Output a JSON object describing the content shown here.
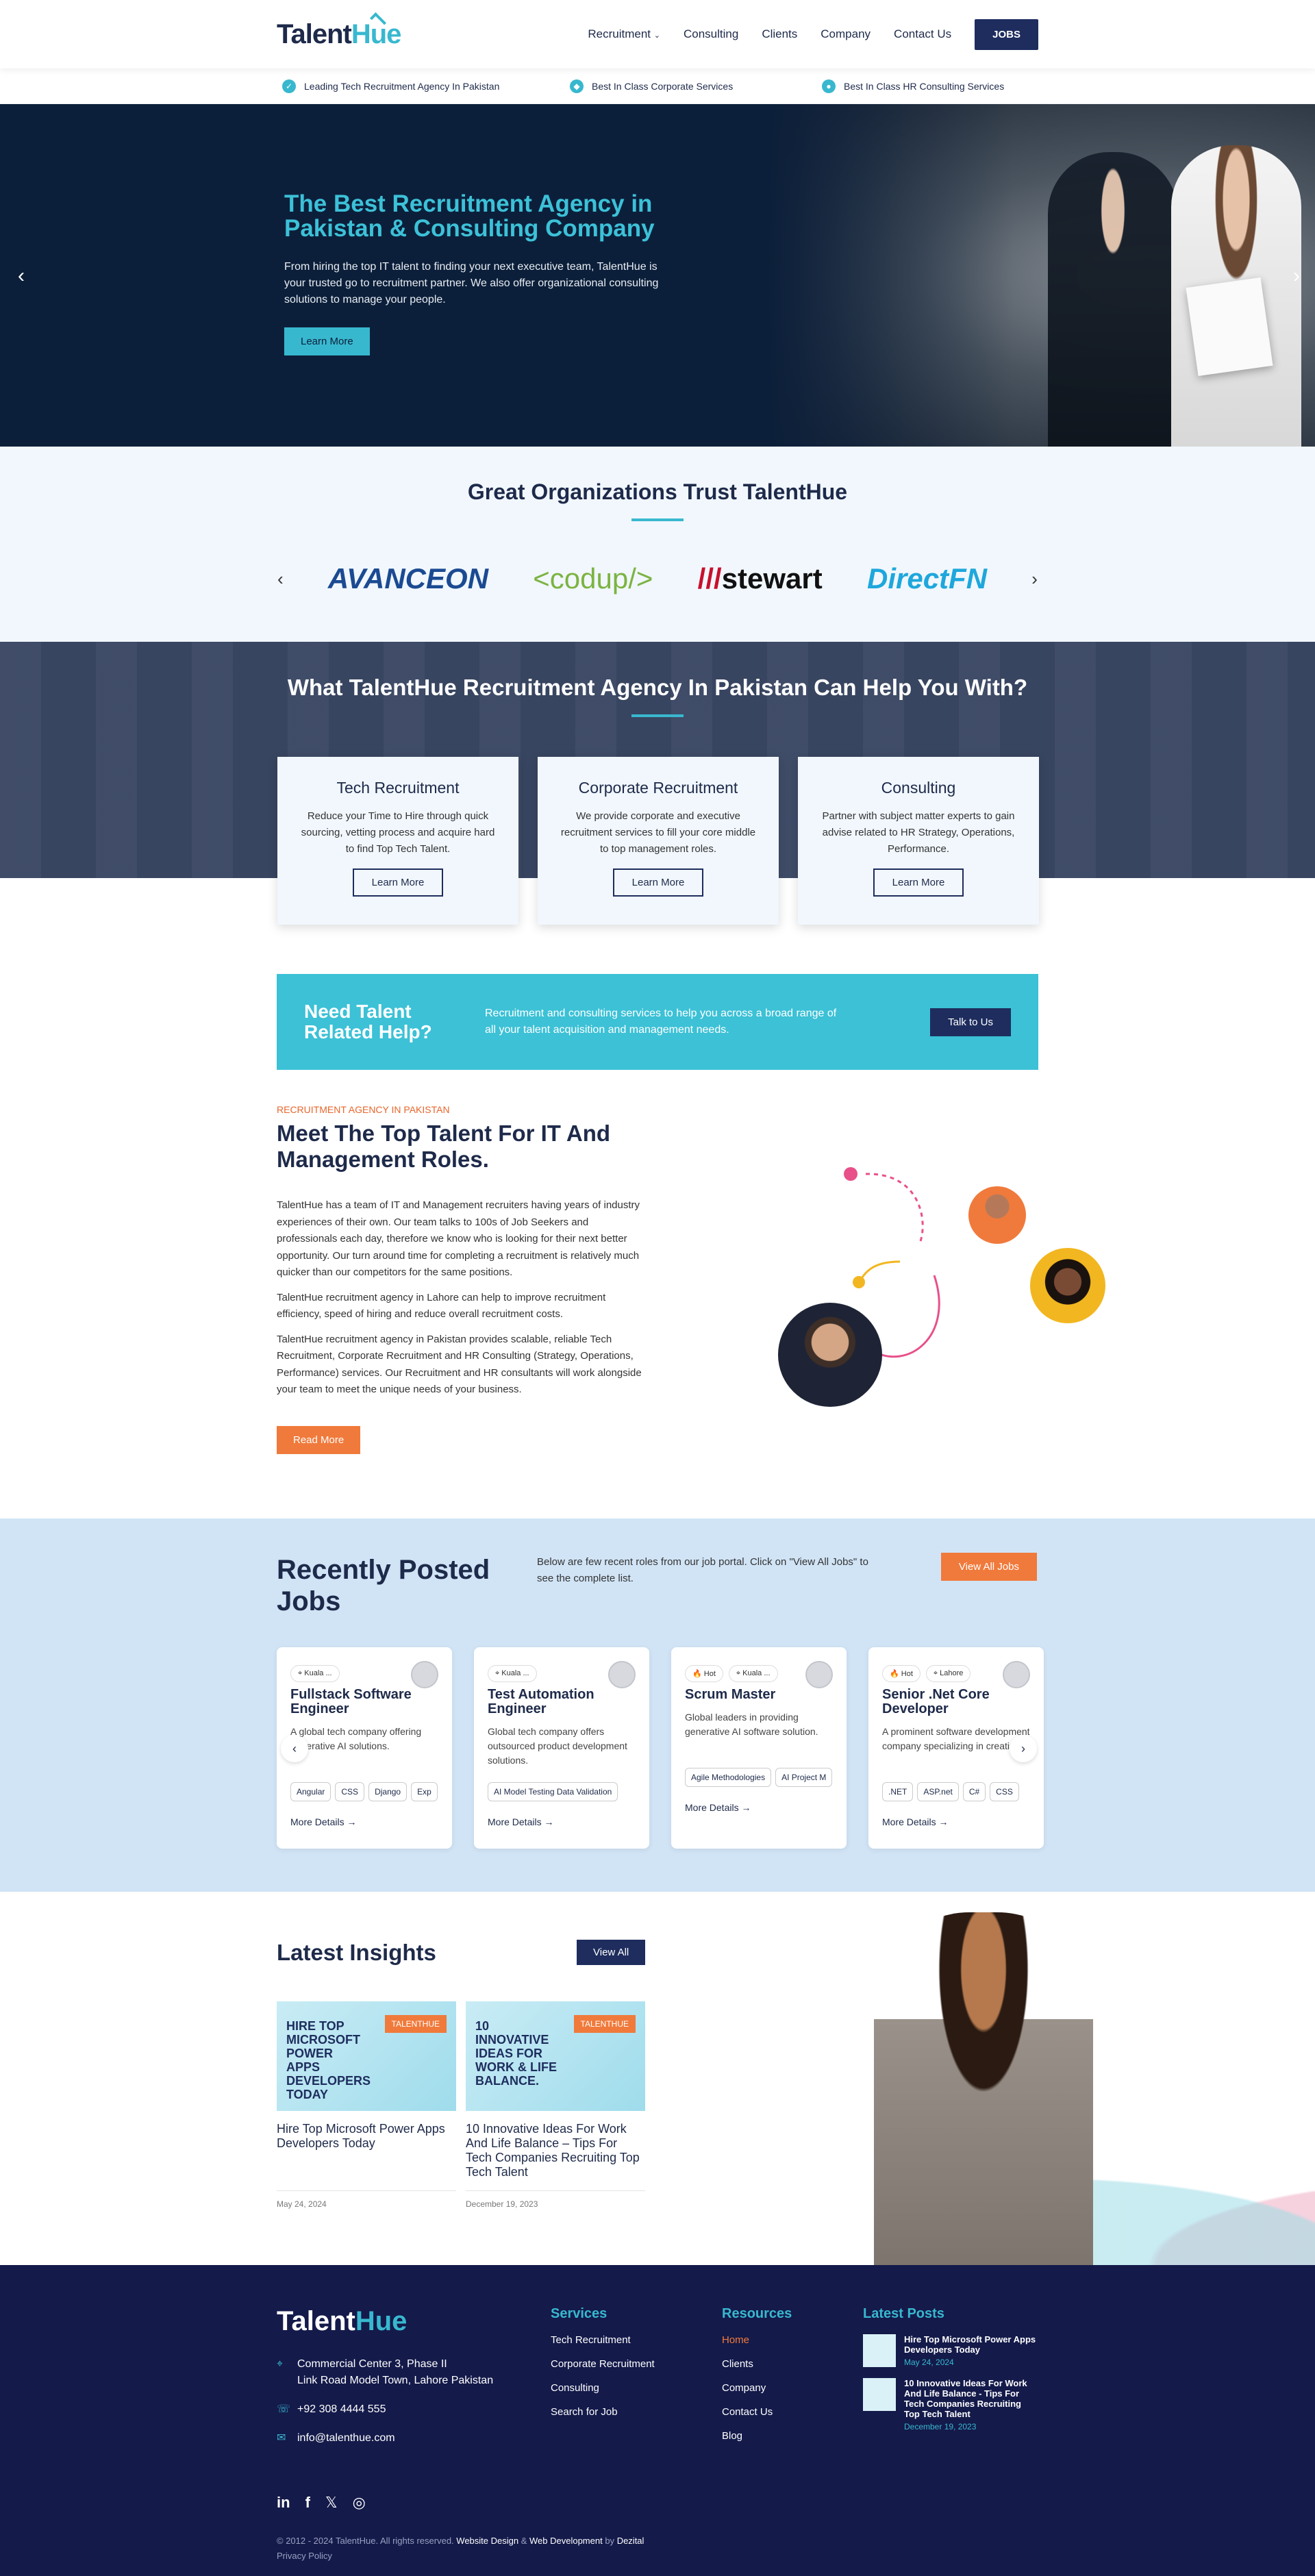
{
  "header": {
    "logo_a": "Talent",
    "logo_b": "Hue",
    "nav": [
      "Recruitment",
      "Consulting",
      "Clients",
      "Company",
      "Contact Us"
    ],
    "jobs_btn": "JOBS"
  },
  "topbar": [
    "Leading Tech Recruitment Agency In Pakistan",
    "Best In Class Corporate Services",
    "Best In Class HR Consulting Services"
  ],
  "hero": {
    "title": "The Best Recruitment Agency in Pakistan & Consulting Company",
    "text": "From hiring the top IT talent to finding your next executive team, TalentHue is your trusted go to recruitment partner. We also offer organizational consulting solutions to manage your people.",
    "button": "Learn More"
  },
  "trust": {
    "title": "Great Organizations Trust TalentHue",
    "logos": [
      "AVANCEON",
      "<codup/>",
      "stewart",
      "DirectFN"
    ]
  },
  "help": {
    "title": "What TalentHue Recruitment Agency In Pakistan Can Help You With?",
    "cards": [
      {
        "title": "Tech Recruitment",
        "text": "Reduce your Time to Hire through quick sourcing, vetting process and acquire hard to find Top Tech Talent.",
        "button": "Learn More"
      },
      {
        "title": "Corporate Recruitment",
        "text": "We provide corporate and executive recruitment services to fill your core middle to top management roles.",
        "button": "Learn More"
      },
      {
        "title": "Consulting",
        "text": "Partner with subject matter experts to gain advise related to HR Strategy, Operations, Performance.",
        "button": "Learn More"
      }
    ]
  },
  "cta": {
    "title": "Need Talent Related Help?",
    "text": "Recruitment and consulting services to help you across a broad range of all your talent acquisition and management needs.",
    "button": "Talk to Us"
  },
  "about": {
    "kicker": "RECRUITMENT AGENCY IN PAKISTAN",
    "title": "Meet The Top Talent For IT And Management Roles.",
    "p1": "TalentHue has a team of IT and Management recruiters having years of industry experiences of their own. Our team talks to 100s of Job Seekers and professionals each day, therefore we know who is looking for their next better opportunity. Our turn around time for completing a recruitment is relatively much quicker than our competitors for the same positions.",
    "p2": "TalentHue recruitment agency in Lahore can help to improve recruitment efficiency, speed of hiring and reduce overall recruitment costs.",
    "p3": "TalentHue recruitment agency in Pakistan provides scalable, reliable Tech Recruitment, Corporate Recruitment and HR Consulting (Strategy, Operations, Performance) services. Our Recruitment and HR consultants will work alongside your team to meet the unique needs of your business.",
    "button": "Read More"
  },
  "jobs": {
    "title": "Recently Posted Jobs",
    "desc": "Below are few recent roles from our job portal. Click on \"View All Jobs\" to see the complete list.",
    "button": "View All Jobs",
    "cards": [
      {
        "tags": [
          "Kuala ..."
        ],
        "title": "Fullstack Software Engineer",
        "text": "A global tech company offering generative AI solutions.",
        "skills": [
          "Angular",
          "CSS",
          "Django",
          "Exp"
        ],
        "more": "More Details →"
      },
      {
        "tags": [
          "Kuala ..."
        ],
        "title": "Test Automation Engineer",
        "text": "Global tech company offers outsourced product development solutions.",
        "skills": [
          "AI Model Testing Data Validation"
        ],
        "more": "More Details →"
      },
      {
        "tags": [
          "Hot",
          "Kuala ..."
        ],
        "title": "Scrum Master",
        "text": "Global leaders in providing generative AI software solution.",
        "skills": [
          "Agile Methodologies",
          "AI Project M"
        ],
        "more": "More Details →"
      },
      {
        "tags": [
          "Hot",
          "Lahore"
        ],
        "title": "Senior .Net Core Developer",
        "text": "A prominent software development company specializing in creating...",
        "skills": [
          ".NET",
          "ASP.net",
          "C#",
          "CSS"
        ],
        "more": "More Details →"
      }
    ]
  },
  "insights": {
    "title": "Latest Insights",
    "button": "View All",
    "posts": [
      {
        "img_title": "HIRE TOP MICROSOFT POWER APPS DEVELOPERS TODAY",
        "badge": "TALENTHUE",
        "title": "Hire Top Microsoft Power Apps Developers Today",
        "date": "May 24, 2024"
      },
      {
        "img_title": "10 INNOVATIVE IDEAS FOR WORK & LIFE BALANCE.",
        "badge": "TALENTHUE",
        "title": "10 Innovative Ideas For Work And Life Balance – Tips For Tech Companies Recruiting Top Tech Talent",
        "date": "December 19, 2023"
      }
    ]
  },
  "footer": {
    "address1": "Commercial Center 3, Phase II",
    "address2": "Link Road Model Town, Lahore Pakistan",
    "phone": "+92 308 4444 555",
    "email": "info@talenthue.com",
    "services_title": "Services",
    "services": [
      "Tech Recruitment",
      "Corporate Recruitment",
      "Consulting",
      "Search for Job"
    ],
    "resources_title": "Resources",
    "resources": [
      "Home",
      "Clients",
      "Company",
      "Contact Us",
      "Blog"
    ],
    "posts_title": "Latest Posts",
    "posts": [
      {
        "t": "Hire Top Microsoft Power Apps Developers Today",
        "d": "May 24, 2024"
      },
      {
        "t": "10 Innovative Ideas For Work And Life Balance - Tips For Tech Companies Recruiting Top Tech Talent",
        "d": "December 19, 2023"
      }
    ],
    "copy_a": "© 2012 - 2024 TalentHue. All rights reserved. ",
    "copy_b": "Website Design",
    "copy_c": " & ",
    "copy_d": "Web Development",
    "copy_e": " by ",
    "copy_f": "Dezital",
    "privacy": "Privacy Policy"
  }
}
